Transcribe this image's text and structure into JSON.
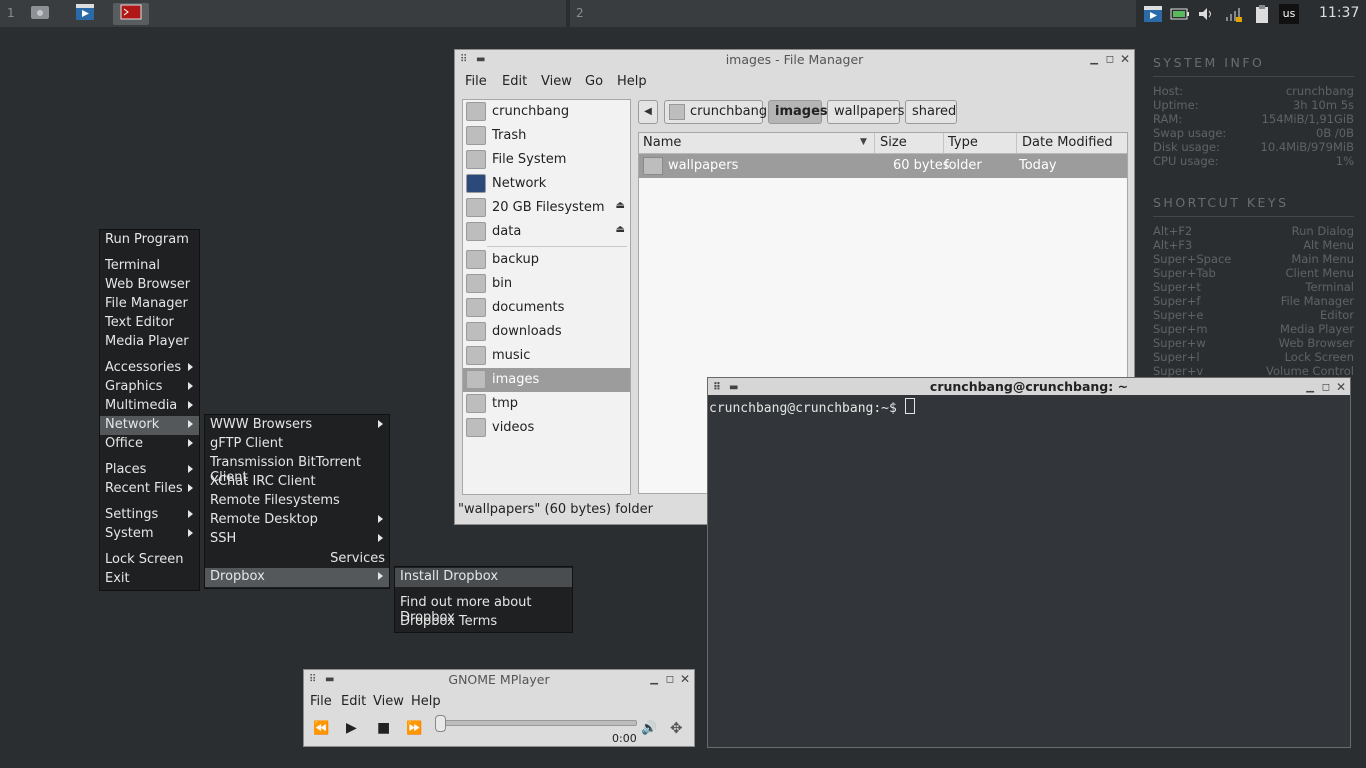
{
  "panel": {
    "workspace1": "1",
    "workspace2": "2",
    "keyboard_layout": "us",
    "clock": "11:37"
  },
  "conky": {
    "system_info_title": "SYSTEM INFO",
    "system_rows": [
      {
        "label": "Host:",
        "value": "crunchbang"
      },
      {
        "label": "Uptime:",
        "value": "3h 10m 5s"
      },
      {
        "label": "RAM:",
        "value": "154MiB/1,91GiB"
      },
      {
        "label": "Swap usage:",
        "value": "0B  /0B"
      },
      {
        "label": "Disk usage:",
        "value": "10.4MiB/979MiB"
      },
      {
        "label": "CPU usage:",
        "value": "1%"
      }
    ],
    "shortcut_title": "SHORTCUT KEYS",
    "shortcut_rows": [
      {
        "label": "Alt+F2",
        "value": "Run Dialog"
      },
      {
        "label": "Alt+F3",
        "value": "Alt Menu"
      },
      {
        "label": "Super+Space",
        "value": "Main Menu"
      },
      {
        "label": "Super+Tab",
        "value": "Client Menu"
      },
      {
        "label": "Super+t",
        "value": "Terminal"
      },
      {
        "label": "Super+f",
        "value": "File Manager"
      },
      {
        "label": "Super+e",
        "value": "Editor"
      },
      {
        "label": "Super+m",
        "value": "Media Player"
      },
      {
        "label": "Super+w",
        "value": "Web Browser"
      },
      {
        "label": "Super+l",
        "value": "Lock Screen"
      },
      {
        "label": "Super+v",
        "value": "Volume Control"
      }
    ]
  },
  "file_manager": {
    "title": "images - File Manager",
    "menu": [
      "File",
      "Edit",
      "View",
      "Go",
      "Help"
    ],
    "sidebar": [
      {
        "label": "crunchbang",
        "icon": "home-icon"
      },
      {
        "label": "Trash",
        "icon": "trash-icon"
      },
      {
        "label": "File System",
        "icon": "drive-icon"
      },
      {
        "label": "Network",
        "icon": "network-icon"
      },
      {
        "label": "20 GB Filesystem",
        "icon": "drive-icon"
      },
      {
        "label": "data",
        "icon": "drive-icon"
      },
      {
        "label": "backup",
        "icon": "folder-icon"
      },
      {
        "label": "bin",
        "icon": "folder-icon"
      },
      {
        "label": "documents",
        "icon": "folder-icon"
      },
      {
        "label": "downloads",
        "icon": "folder-icon"
      },
      {
        "label": "music",
        "icon": "folder-icon"
      },
      {
        "label": "images",
        "icon": "folder-icon"
      },
      {
        "label": "tmp",
        "icon": "folder-icon"
      },
      {
        "label": "videos",
        "icon": "folder-icon"
      }
    ],
    "breadcrumbs": [
      "crunchbang",
      "images",
      "wallpapers",
      "shared"
    ],
    "columns": [
      "Name",
      "Size",
      "Type",
      "Date Modified"
    ],
    "rows": [
      {
        "name": "wallpapers",
        "size": "60 bytes",
        "type": "folder",
        "modified": "Today"
      }
    ],
    "status": "\"wallpapers\" (60 bytes) folder"
  },
  "main_menu": {
    "items": [
      "Run Program",
      "Terminal",
      "Web Browser",
      "File Manager",
      "Text Editor",
      "Media Player",
      "Accessories",
      "Graphics",
      "Multimedia",
      "Network",
      "Office",
      "Places",
      "Recent Files",
      "Settings",
      "System",
      "Lock Screen",
      "Exit"
    ]
  },
  "network_menu": {
    "items": [
      "WWW Browsers",
      "gFTP Client",
      "Transmission BitTorrent Client",
      "XChat IRC Client",
      "Remote Filesystems",
      "Remote Desktop",
      "SSH"
    ],
    "services_label": "Services",
    "dropbox": "Dropbox"
  },
  "dropbox_menu": {
    "items": [
      "Install Dropbox",
      "Find out more about Dropbox",
      "Dropbox Terms"
    ]
  },
  "mplayer": {
    "title": "GNOME MPlayer",
    "menu": [
      "File",
      "Edit",
      "View",
      "Help"
    ],
    "time": "0:00",
    "progress": 0
  },
  "terminal": {
    "title": "crunchbang@crunchbang: ~",
    "prompt": "crunchbang@crunchbang:~$ "
  }
}
